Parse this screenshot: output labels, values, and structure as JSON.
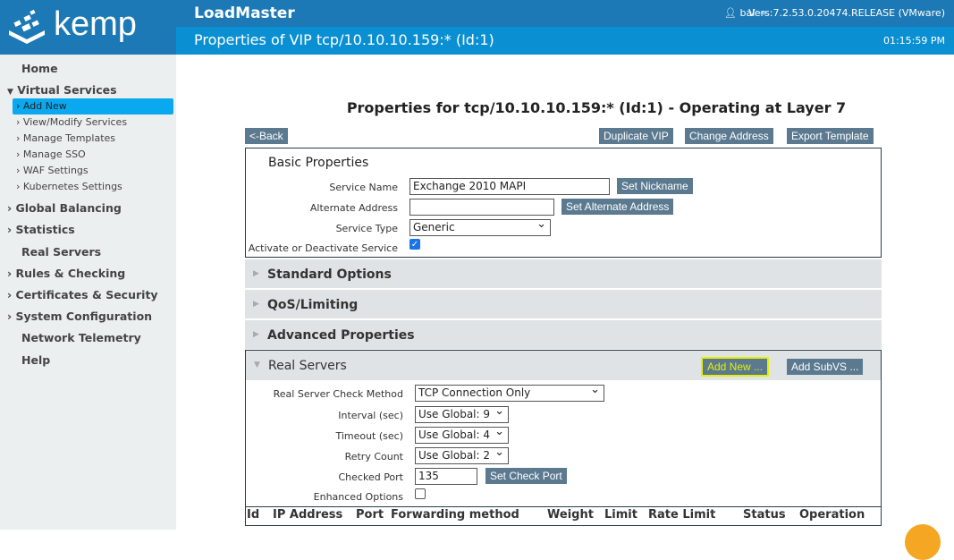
{
  "header": {
    "logo": "kemp",
    "app_title": "LoadMaster",
    "user": "bal",
    "version": "Vers:7.2.53.0.20474.RELEASE (VMware)",
    "page_title": "Properties of VIP tcp/10.10.10.159:* (Id:1)",
    "time": "01:15:59 PM"
  },
  "sidebar": {
    "home": "Home",
    "virtual_services": "Virtual Services",
    "sub": [
      "Add New",
      "View/Modify Services",
      "Manage Templates",
      "Manage SSO",
      "WAF Settings",
      "Kubernetes Settings"
    ],
    "global_balancing": "Global Balancing",
    "statistics": "Statistics",
    "real_servers": "Real Servers",
    "rules": "Rules & Checking",
    "certs": "Certificates & Security",
    "sysconfig": "System Configuration",
    "telemetry": "Network Telemetry",
    "help": "Help"
  },
  "main": {
    "heading": "Properties for tcp/10.10.10.159:* (Id:1) - Operating at Layer 7",
    "buttons": {
      "back": "<-Back",
      "duplicate": "Duplicate VIP",
      "change_address": "Change Address",
      "export": "Export Template"
    },
    "basic": {
      "title": "Basic Properties",
      "service_name_label": "Service Name",
      "service_name": "Exchange 2010 MAPI",
      "set_nickname": "Set Nickname",
      "alt_label": "Alternate Address",
      "alt_value": "",
      "set_alt": "Set Alternate Address",
      "type_label": "Service Type",
      "type_value": "Generic",
      "activate_label": "Activate or Deactivate Service",
      "activate_checked": true
    },
    "sections": [
      "Standard Options",
      "QoS/Limiting",
      "Advanced Properties"
    ],
    "real_servers": {
      "title": "Real Servers",
      "add_new": "Add New ...",
      "add_subvs": "Add SubVS ...",
      "check_method_label": "Real Server Check Method",
      "check_method": "TCP Connection Only",
      "interval_label": "Interval (sec)",
      "interval": "Use Global: 9",
      "timeout_label": "Timeout (sec)",
      "timeout": "Use Global: 4",
      "retry_label": "Retry Count",
      "retry": "Use Global: 2",
      "port_label": "Checked Port",
      "port": "135",
      "set_port": "Set Check Port",
      "enhanced_label": "Enhanced Options",
      "enhanced_checked": false,
      "columns": [
        "Id",
        "IP Address",
        "Port",
        "Forwarding method",
        "Weight",
        "Limit",
        "Rate Limit",
        "Status",
        "Operation"
      ]
    }
  },
  "colors": {
    "header": "#1c79b6",
    "subheader": "#0a90d2",
    "button": "#5b7a90",
    "highlight": "#e6f000"
  }
}
